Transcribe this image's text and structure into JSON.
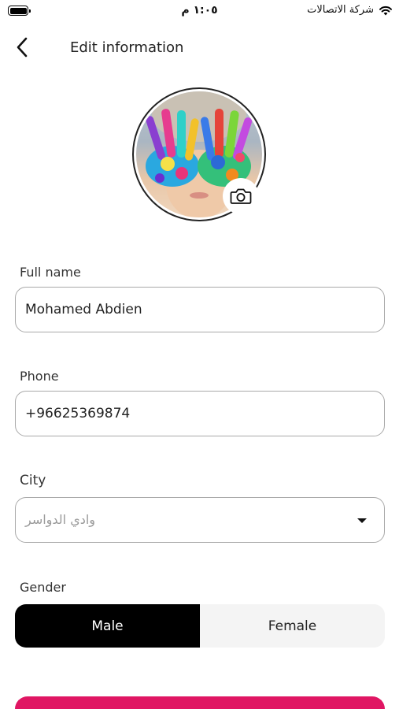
{
  "status_bar": {
    "time": "١:٠٥ م",
    "carrier": "شركة الاتصالات"
  },
  "header": {
    "title": "Edit information"
  },
  "form": {
    "full_name": {
      "label": "Full name",
      "value": "Mohamed Abdien"
    },
    "phone": {
      "label": "Phone",
      "value": "+96625369874"
    },
    "city": {
      "label": "City",
      "value": "وادي الدواسر"
    },
    "gender": {
      "label": "Gender",
      "options": [
        "Male",
        "Female"
      ],
      "selected": "Male"
    }
  },
  "colors": {
    "accent": "#e01663",
    "selected_segment": "#000000",
    "unselected_segment": "#f4f4f4"
  },
  "icons": [
    "back-icon",
    "camera-icon",
    "wifi-icon",
    "battery-icon",
    "dropdown-caret-icon"
  ]
}
